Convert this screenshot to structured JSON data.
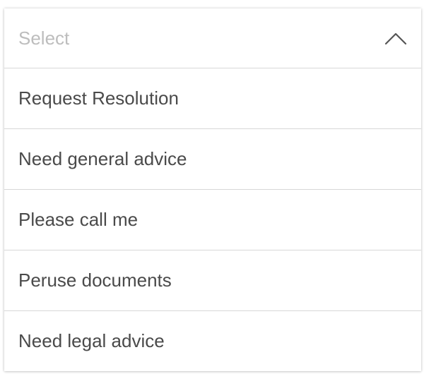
{
  "select": {
    "placeholder": "Select",
    "toggle_icon": "chevron-up-icon",
    "options": [
      {
        "label": "Request Resolution"
      },
      {
        "label": "Need general advice"
      },
      {
        "label": "Please call me"
      },
      {
        "label": "Peruse documents"
      },
      {
        "label": "Need legal advice"
      }
    ]
  },
  "colors": {
    "placeholder_text": "#bdbdbd",
    "option_text": "#4a4a4a",
    "divider": "#d7d7d7",
    "chevron": "#555555"
  }
}
